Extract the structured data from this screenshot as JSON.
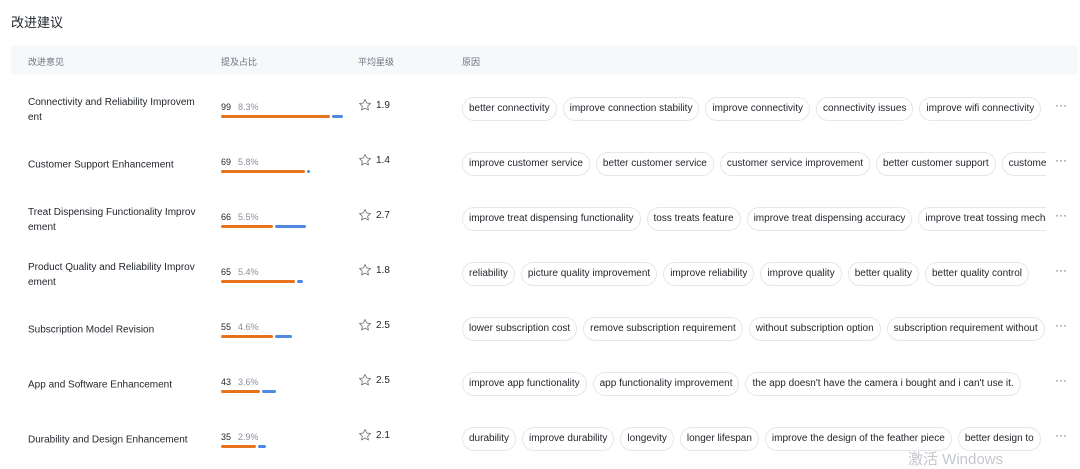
{
  "page": {
    "title": "改进建议"
  },
  "columns": {
    "suggestion": "改进意见",
    "mentions": "提及占比",
    "avg_rating": "平均星级",
    "reasons": "原因"
  },
  "rows": [
    {
      "name": "Connectivity and Reliability Improvement",
      "count": "99",
      "percent": "8.3%",
      "orange_fraction": 0.78,
      "blue_fraction": 0.08,
      "rating": "1.9",
      "tags": [
        "better connectivity",
        "improve connection stability",
        "improve connectivity",
        "connectivity issues",
        "improve wifi connectivity"
      ]
    },
    {
      "name": "Customer Support Enhancement",
      "count": "69",
      "percent": "5.8%",
      "orange_fraction": 0.6,
      "blue_fraction": 0.02,
      "rating": "1.4",
      "tags": [
        "improve customer service",
        "better customer service",
        "customer service improvement",
        "better customer support",
        "customer"
      ]
    },
    {
      "name": "Treat Dispensing Functionality Improvement",
      "count": "66",
      "percent": "5.5%",
      "orange_fraction": 0.37,
      "blue_fraction": 0.22,
      "rating": "2.7",
      "tags": [
        "improve treat dispensing functionality",
        "toss treats feature",
        "improve treat dispensing accuracy",
        "improve treat tossing mechanism"
      ]
    },
    {
      "name": "Product Quality and Reliability Improvement",
      "count": "65",
      "percent": "5.4%",
      "orange_fraction": 0.53,
      "blue_fraction": 0.04,
      "rating": "1.8",
      "tags": [
        "reliability",
        "picture quality improvement",
        "improve reliability",
        "improve quality",
        "better quality",
        "better quality control"
      ]
    },
    {
      "name": "Subscription Model Revision",
      "count": "55",
      "percent": "4.6%",
      "orange_fraction": 0.37,
      "blue_fraction": 0.12,
      "rating": "2.5",
      "tags": [
        "lower subscription cost",
        "remove subscription requirement",
        "without subscription option",
        "subscription requirement without"
      ]
    },
    {
      "name": "App and Software Enhancement",
      "count": "43",
      "percent": "3.6%",
      "orange_fraction": 0.28,
      "blue_fraction": 0.1,
      "rating": "2.5",
      "tags": [
        "improve app functionality",
        "app functionality improvement",
        "the app doesn't have the camera i bought and i can't use it."
      ]
    },
    {
      "name": "Durability and Design Enhancement",
      "count": "35",
      "percent": "2.9%",
      "orange_fraction": 0.25,
      "blue_fraction": 0.06,
      "rating": "2.1",
      "tags": [
        "durability",
        "improve durability",
        "longevity",
        "longer lifespan",
        "improve the design of the feather piece",
        "better design to"
      ]
    }
  ],
  "colors": {
    "accent_orange": "#e8731d",
    "accent_blue": "#4e88e3",
    "header_bg": "#f7f8fa"
  },
  "icons": {
    "rating": "star-outline-icon",
    "row_menu": "more-horizontal-icon"
  },
  "more_glyph": "···",
  "watermark": "激活 Windows"
}
